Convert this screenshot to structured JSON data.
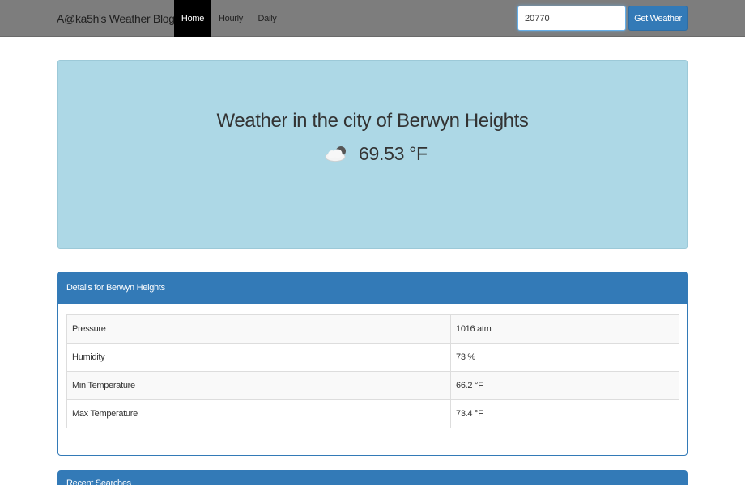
{
  "navbar": {
    "brand": "A@ka5h's Weather Blog",
    "items": [
      {
        "label": "Home",
        "active": true
      },
      {
        "label": "Hourly",
        "active": false
      },
      {
        "label": "Daily",
        "active": false
      }
    ],
    "search": {
      "value": "20770",
      "placeholder": ""
    },
    "button_label": "Get Weather"
  },
  "hero": {
    "title": "Weather in the city of Berwyn Heights",
    "temperature": "69.53 °F",
    "icon": "partly-cloudy-icon"
  },
  "details": {
    "heading": "Details for Berwyn Heights",
    "rows": [
      {
        "label": "Pressure",
        "value": "1016 atm"
      },
      {
        "label": "Humidity",
        "value": "73 %"
      },
      {
        "label": "Min Temperature",
        "value": "66.2 °F"
      },
      {
        "label": "Max Temperature",
        "value": "73.4 °F"
      }
    ]
  },
  "recent": {
    "heading": "Recent Searches"
  },
  "colors": {
    "navbar": "#7d7d7d",
    "active_tab": "#000000",
    "primary": "#337ab7",
    "hero_bg": "#add8e6"
  }
}
